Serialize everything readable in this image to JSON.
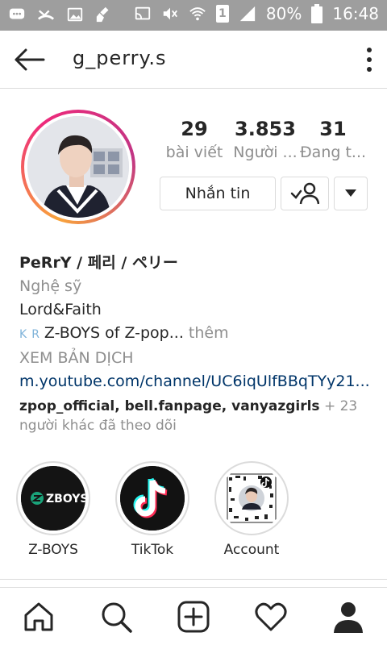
{
  "status_bar": {
    "battery_percent": "80%",
    "time": "16:48",
    "sim_slot": "1"
  },
  "header": {
    "username": "g_perry.s"
  },
  "stats": {
    "posts_count": "29",
    "posts_label": "bài viết",
    "followers_count": "3.853",
    "followers_label": "Người ...",
    "following_count": "31",
    "following_label": "Đang t..."
  },
  "buttons": {
    "message_label": "Nhắn tin"
  },
  "bio": {
    "name": "PeRrY / 페리 / ペリー",
    "category": "Nghệ sỹ",
    "line1": "Lord&Faith",
    "badge_k": "K",
    "badge_r": "R",
    "line2_text": "Z-BOYS of Z-pop...",
    "line2_more": "thêm",
    "translate": "XEM BẢN DỊCH",
    "link": "m.youtube.com/channel/UC6iqUlfBBqTYy21...",
    "followed_by_names": "zpop_official, bell.fanpage, vanyazgirls",
    "followed_by_suffix": " + 23 người khác đã theo dõi"
  },
  "highlights": [
    {
      "label": "Z-BOYS",
      "logo_text": "ZBOYS"
    },
    {
      "label": "TikTok"
    },
    {
      "label": "Account"
    }
  ],
  "colors": {
    "status_bar_bg": "#9e9e9e",
    "link": "#003569",
    "muted": "#8e8e8e",
    "tiktok_cyan": "#25f4ee",
    "tiktok_red": "#fe2c55"
  },
  "icons": {
    "back": "arrow-left-icon",
    "more": "vertical-dots-icon",
    "follow": "person-check-icon",
    "dropdown": "caret-down-icon",
    "home": "home-icon",
    "search": "search-icon",
    "add": "add-post-icon",
    "activity": "heart-icon",
    "profile": "profile-icon"
  }
}
